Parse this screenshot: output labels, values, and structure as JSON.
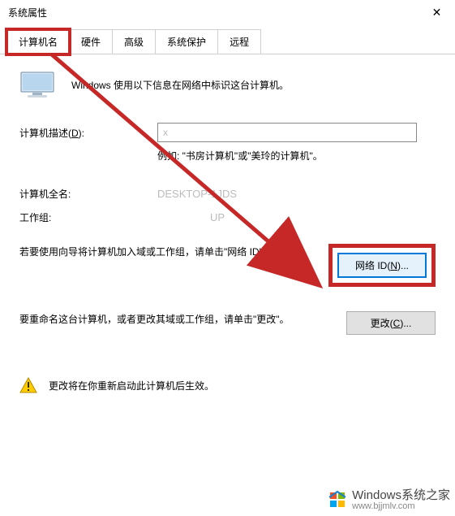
{
  "window": {
    "title": "系统属性",
    "close_glyph": "✕"
  },
  "tabs": {
    "computer_name": "计算机名",
    "hardware": "硬件",
    "advanced": "高级",
    "system_protection": "系统保护",
    "remote": "远程"
  },
  "intro": {
    "text": "Windows 使用以下信息在网络中标识这台计算机。"
  },
  "fields": {
    "description_label_pre": "计算机描述(",
    "description_label_u": "D",
    "description_label_post": "):",
    "description_value": "x",
    "example": "例如: \"书房计算机\"或\"美玲的计算机\"。",
    "fullname_label": "计算机全名:",
    "fullname_value": "DESKTOP-1JDS",
    "workgroup_label": "工作组:",
    "workgroup_value": "                  UP"
  },
  "actions": {
    "netid_desc": "若要使用向导将计算机加入域或工作组，请单击\"网络 ID\"。",
    "netid_btn_pre": "网络 ID(",
    "netid_btn_u": "N",
    "netid_btn_post": ")...",
    "change_desc": "要重命名这台计算机，或者更改其域或工作组，请单击\"更改\"。",
    "change_btn_pre": "更改(",
    "change_btn_u": "C",
    "change_btn_post": ")..."
  },
  "notice": {
    "text": "更改将在你重新启动此计算机后生效。"
  },
  "watermark": {
    "line1": "Windows系统之家",
    "line2": "www.bjjmlv.com"
  }
}
